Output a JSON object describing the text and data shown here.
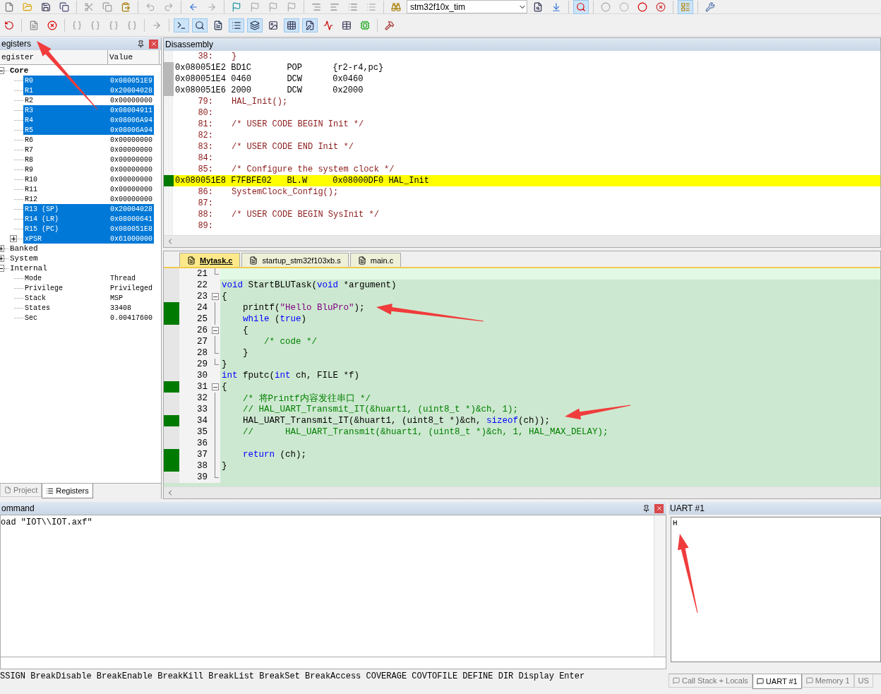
{
  "toolbar": {
    "target": "stm32f10x_tim"
  },
  "registers": {
    "title": "egisters",
    "columns": [
      "egister",
      "Value"
    ],
    "tree": [
      {
        "name": "Core",
        "bold": true,
        "expanded": true,
        "children": [
          {
            "name": "R0",
            "value": "0x080051E9",
            "selected": true
          },
          {
            "name": "R1",
            "value": "0x20004028",
            "selected": true
          },
          {
            "name": "R2",
            "value": "0x00000000",
            "selected": false
          },
          {
            "name": "R3",
            "value": "0x08004911",
            "selected": true
          },
          {
            "name": "R4",
            "value": "0x08006A94",
            "selected": true
          },
          {
            "name": "R5",
            "value": "0x08006A94",
            "selected": true
          },
          {
            "name": "R6",
            "value": "0x00000000",
            "selected": false
          },
          {
            "name": "R7",
            "value": "0x00000000",
            "selected": false
          },
          {
            "name": "R8",
            "value": "0x00000000",
            "selected": false
          },
          {
            "name": "R9",
            "value": "0x00000000",
            "selected": false
          },
          {
            "name": "R10",
            "value": "0x00000000",
            "selected": false
          },
          {
            "name": "R11",
            "value": "0x00000000",
            "selected": false
          },
          {
            "name": "R12",
            "value": "0x00000000",
            "selected": false
          },
          {
            "name": "R13 (SP)",
            "value": "0x20004028",
            "selected": true
          },
          {
            "name": "R14 (LR)",
            "value": "0x08000641",
            "selected": true
          },
          {
            "name": "R15 (PC)",
            "value": "0x080051E8",
            "selected": true
          },
          {
            "name": "xPSR",
            "value": "0x61000000",
            "selected": true,
            "expanded": false
          }
        ]
      },
      {
        "name": "Banked",
        "bold": false,
        "expanded": false
      },
      {
        "name": "System",
        "bold": false,
        "expanded": false
      },
      {
        "name": "Internal",
        "bold": false,
        "expanded": true,
        "children": [
          {
            "name": "Mode",
            "value": "Thread",
            "selected": false
          },
          {
            "name": "Privilege",
            "value": "Privileged",
            "selected": false
          },
          {
            "name": "Stack",
            "value": "MSP",
            "selected": false
          },
          {
            "name": "States",
            "value": "33408",
            "selected": false
          },
          {
            "name": "Sec",
            "value": "0.00417600",
            "selected": false
          }
        ]
      }
    ],
    "tabs": [
      {
        "label": "Project",
        "selected": false
      },
      {
        "label": "Registers",
        "selected": true
      }
    ]
  },
  "disassembly": {
    "title": "Disassembly",
    "lines": [
      {
        "kind": "src",
        "number": "38:",
        "text": "}"
      },
      {
        "kind": "asm",
        "address": "0x080051E2",
        "code": "BD1C",
        "mnemonic": "POP",
        "operand": "{r2-r4,pc}",
        "covered": true,
        "current": false
      },
      {
        "kind": "asm",
        "address": "0x080051E4",
        "code": "0460",
        "mnemonic": "DCW",
        "operand": "0x0460",
        "covered": true,
        "current": false
      },
      {
        "kind": "asm",
        "address": "0x080051E6",
        "code": "2000",
        "mnemonic": "DCW",
        "operand": "0x2000",
        "covered": true,
        "current": false
      },
      {
        "kind": "src",
        "number": "79:",
        "text": "HAL_Init();"
      },
      {
        "kind": "src",
        "number": "80:"
      },
      {
        "kind": "src",
        "number": "81:",
        "text": "/* USER CODE BEGIN Init */"
      },
      {
        "kind": "src",
        "number": "82:"
      },
      {
        "kind": "src",
        "number": "83:",
        "text": "/* USER CODE END Init */"
      },
      {
        "kind": "src",
        "number": "84:"
      },
      {
        "kind": "src",
        "number": "85:",
        "text": "/* Configure the system clock */"
      },
      {
        "kind": "asm",
        "address": "0x080051E8",
        "code": "F7FBFE02",
        "mnemonic": "BL.W",
        "operand": "0x08000DF0 HAL_Init",
        "covered": false,
        "current": true
      },
      {
        "kind": "src",
        "number": "86:",
        "text": "SystemClock_Config();"
      },
      {
        "kind": "src",
        "number": "87:"
      },
      {
        "kind": "src",
        "number": "88:",
        "text": "/* USER CODE BEGIN SysInit */"
      },
      {
        "kind": "src",
        "number": "89:"
      }
    ]
  },
  "editor": {
    "tabs": [
      {
        "label": "Mytask.c",
        "selected": true
      },
      {
        "label": "startup_stm32f103xb.s",
        "selected": false
      },
      {
        "label": "main.c",
        "selected": false
      }
    ],
    "lines": [
      {
        "number": "21",
        "kind": "fold-end",
        "executed": false,
        "current": true
      },
      {
        "number": "22",
        "kind": "plain",
        "executed": false,
        "current": false,
        "segments": [
          {
            "kind": "kw",
            "text": "void"
          },
          {
            "kind": "plain",
            "text": " StartBLUTask("
          },
          {
            "kind": "kw",
            "text": "void"
          },
          {
            "kind": "plain",
            "text": " *argument)"
          }
        ]
      },
      {
        "number": "23",
        "kind": "fold-start",
        "executed": false,
        "current": false,
        "segments": [
          {
            "kind": "plain",
            "text": "{"
          }
        ]
      },
      {
        "number": "24",
        "kind": "fold-body",
        "executed": true,
        "current": false,
        "segments": [
          {
            "kind": "plain",
            "text": "    printf("
          },
          {
            "kind": "str",
            "text": "\"Hello BluPro\""
          },
          {
            "kind": "plain",
            "text": ");"
          }
        ]
      },
      {
        "number": "25",
        "kind": "fold-body",
        "executed": true,
        "current": false,
        "segments": [
          {
            "kind": "kw",
            "text": "    while"
          },
          {
            "kind": "plain",
            "text": " ("
          },
          {
            "kind": "kw",
            "text": "true"
          },
          {
            "kind": "plain",
            "text": ")"
          }
        ]
      },
      {
        "number": "26",
        "kind": "fold-start",
        "executed": false,
        "current": false,
        "segments": [
          {
            "kind": "plain",
            "text": "    {"
          }
        ]
      },
      {
        "number": "27",
        "kind": "fold-body",
        "executed": false,
        "current": false,
        "segments": [
          {
            "kind": "cmt",
            "text": "        /* code */"
          }
        ]
      },
      {
        "number": "28",
        "kind": "fold-end",
        "executed": false,
        "current": false,
        "segments": [
          {
            "kind": "plain",
            "text": "    }"
          }
        ]
      },
      {
        "number": "29",
        "kind": "fold-end",
        "executed": false,
        "current": false,
        "segments": [
          {
            "kind": "plain",
            "text": "}"
          }
        ]
      },
      {
        "number": "30",
        "kind": "plain",
        "executed": false,
        "current": false,
        "segments": [
          {
            "kind": "kw",
            "text": "int"
          },
          {
            "kind": "plain",
            "text": " fputc("
          },
          {
            "kind": "kw",
            "text": "int"
          },
          {
            "kind": "plain",
            "text": " ch, FILE *f)"
          }
        ]
      },
      {
        "number": "31",
        "kind": "fold-start",
        "executed": true,
        "current": false,
        "segments": [
          {
            "kind": "plain",
            "text": "{"
          }
        ]
      },
      {
        "number": "32",
        "kind": "fold-body",
        "executed": false,
        "current": false,
        "segments": [
          {
            "kind": "cmt",
            "text": "    /* 将Printf内容发往串口 */"
          }
        ]
      },
      {
        "number": "33",
        "kind": "fold-body",
        "executed": false,
        "current": false,
        "segments": [
          {
            "kind": "cmt",
            "text": "    // HAL_UART_Transmit_IT(&huart1, (uint8_t *)&ch, 1);"
          }
        ]
      },
      {
        "number": "34",
        "kind": "fold-body",
        "executed": true,
        "current": false,
        "segments": [
          {
            "kind": "plain",
            "text": "    HAL_UART_Transmit_IT(&huart1, (uint8_t *)&ch, "
          },
          {
            "kind": "kw",
            "text": "sizeof"
          },
          {
            "kind": "plain",
            "text": "(ch));"
          }
        ]
      },
      {
        "number": "35",
        "kind": "fold-body",
        "executed": false,
        "current": false,
        "segments": [
          {
            "kind": "cmt",
            "text": "    //      HAL_UART_Transmit(&huart1, (uint8_t *)&ch, 1, HAL_MAX_DELAY);"
          }
        ]
      },
      {
        "number": "36",
        "kind": "fold-body",
        "executed": false,
        "current": false
      },
      {
        "number": "37",
        "kind": "fold-body",
        "executed": true,
        "current": false,
        "segments": [
          {
            "kind": "kw",
            "text": "    return"
          },
          {
            "kind": "plain",
            "text": " (ch);"
          }
        ]
      },
      {
        "number": "38",
        "kind": "fold-body",
        "executed": true,
        "current": false,
        "segments": [
          {
            "kind": "plain",
            "text": "}"
          }
        ]
      },
      {
        "number": "39",
        "kind": "fold-end",
        "executed": false,
        "current": false
      }
    ]
  },
  "command": {
    "title": "ommand",
    "output": "oad \"IOT\\\\IOT.axf\"",
    "hints": "SSIGN BreakDisable BreakEnable BreakKill BreakList BreakSet BreakAccess COVERAGE COVTOFILE DEFINE DIR Display Enter"
  },
  "uart": {
    "title": "UART #1",
    "output": "H",
    "tabs": [
      {
        "label": "Call Stack + Locals",
        "selected": false
      },
      {
        "label": "UART #1",
        "selected": true
      },
      {
        "label": "Memory 1",
        "selected": false
      },
      {
        "label": "US",
        "selected": false
      }
    ]
  }
}
